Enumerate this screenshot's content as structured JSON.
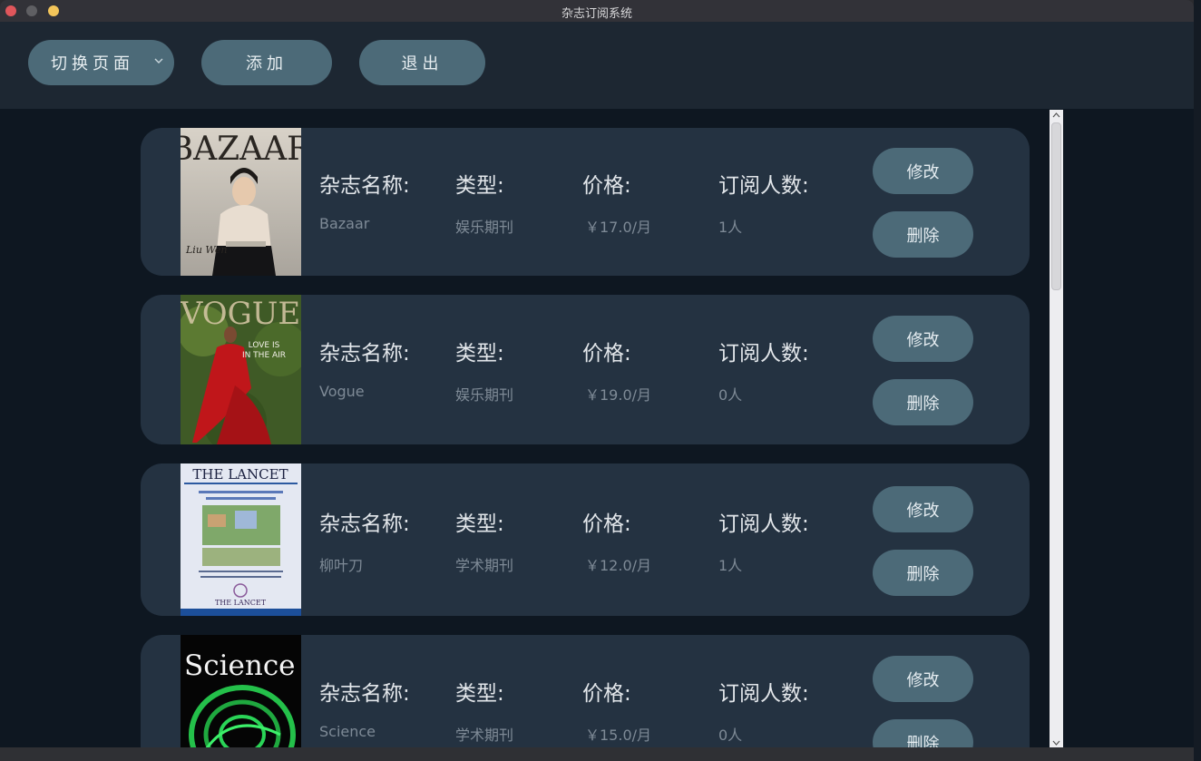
{
  "window": {
    "title": "杂志订阅系统"
  },
  "toolbar": {
    "switch_label": "切换页面",
    "add_label": "添加",
    "exit_label": "退出"
  },
  "labels": {
    "name": "杂志名称:",
    "type": "类型:",
    "price": "价格:",
    "subs": "订阅人数:",
    "edit": "修改",
    "delete": "删除"
  },
  "magazines": [
    {
      "name": "Bazaar",
      "type": "娱乐期刊",
      "price": "￥17.0/月",
      "subscribers": "1人",
      "cover_text": "BAZAAR",
      "cover_caption": "Liu Wen"
    },
    {
      "name": "Vogue",
      "type": "娱乐期刊",
      "price": "￥19.0/月",
      "subscribers": "0人",
      "cover_text": "VOGUE",
      "cover_caption": "LOVE IS IN THE AIR"
    },
    {
      "name": "柳叶刀",
      "type": "学术期刊",
      "price": "￥12.0/月",
      "subscribers": "1人",
      "cover_text": "THE LANCET",
      "cover_caption": "THE LANCET"
    },
    {
      "name": "Science",
      "type": "学术期刊",
      "price": "￥15.0/月",
      "subscribers": "0人",
      "cover_text": "Science",
      "cover_caption": ""
    }
  ],
  "colors": {
    "card_bg": "#243241",
    "button_bg": "#4c6a78",
    "toolbar_bg": "#1d2732",
    "list_bg": "#0e1721"
  }
}
